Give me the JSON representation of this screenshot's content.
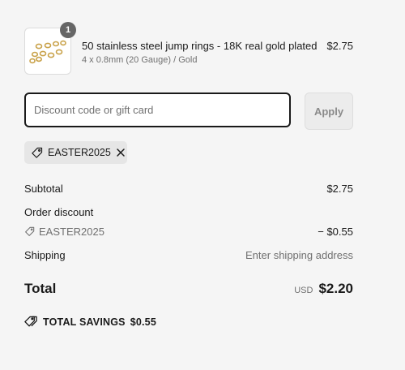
{
  "line_item": {
    "quantity": "1",
    "title": "50 stainless steel jump rings - 18K real gold plated",
    "variant": "4 x 0.8mm (20 Gauge) / Gold",
    "price": "$2.75"
  },
  "discount": {
    "placeholder": "Discount code or gift card",
    "apply_label": "Apply",
    "applied_code": "EASTER2025"
  },
  "summary": {
    "subtotal_label": "Subtotal",
    "subtotal_value": "$2.75",
    "order_discount_label": "Order discount",
    "discount_code": "EASTER2025",
    "discount_value": "− $0.55",
    "shipping_label": "Shipping",
    "shipping_value": "Enter shipping address",
    "total_label": "Total",
    "currency": "USD",
    "total_value": "$2.20",
    "savings_label": "TOTAL SAVINGS",
    "savings_value": "$0.55"
  },
  "icons": {
    "tag": "tag-icon",
    "close": "close-icon",
    "savings": "savings-tags-icon"
  },
  "colors": {
    "background": "#f5f5f5",
    "text": "#1a1a1a",
    "muted": "#707070",
    "badge": "#666666",
    "chip": "#e6e6e6"
  }
}
